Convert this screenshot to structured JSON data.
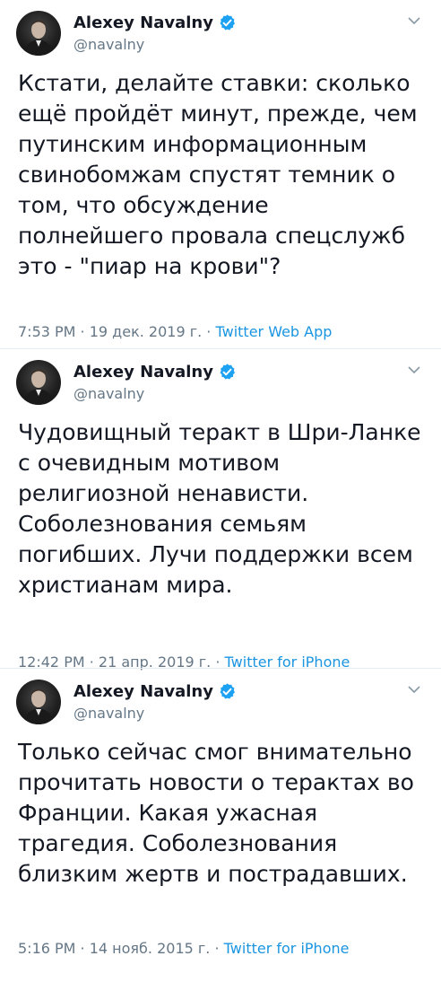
{
  "tweets": [
    {
      "author_name": "Alexey Navalny",
      "handle": "@navalny",
      "text": "Кстати, делайте ставки: сколько\nещё пройдёт минут, прежде, чем\nпутинским информационным\nсвинобомжам спустят темник о\nтом, что обсуждение\nполнейшего провала спецслужб\nэто - \"пиар на крови\"?",
      "time": "7:53 PM",
      "date": "19 дек. 2019 г.",
      "source": "Twitter Web App",
      "separator": " · "
    },
    {
      "author_name": "Alexey Navalny",
      "handle": "@navalny",
      "text": "Чудовищный теракт в Шри-Ланке\nс очевидным мотивом\nрелигиозной ненависти.\nСоболезнования семьям\nпогибших. Лучи поддержки всем\nхристианам мира.",
      "time": "12:42 PM",
      "date": "21 апр. 2019 г.",
      "source": "Twitter for iPhone",
      "separator": " · "
    },
    {
      "author_name": "Alexey Navalny",
      "handle": "@navalny",
      "text": "Только сейчас смог внимательно\nпрочитать новости о терактах во\nФранции. Какая ужасная\nтрагедия. Соболезнования\nблизким жертв и пострадавших.",
      "time": "5:16 PM",
      "date": "14 нояб. 2015 г.",
      "source": "Twitter for iPhone",
      "separator": " · "
    }
  ],
  "colors": {
    "verified": "#1da1f2",
    "link": "#1b95e0",
    "muted": "#657786",
    "text": "#141823"
  },
  "icons": {
    "verified": "verified-badge-icon",
    "chevron": "chevron-down-icon",
    "avatar": "avatar"
  }
}
